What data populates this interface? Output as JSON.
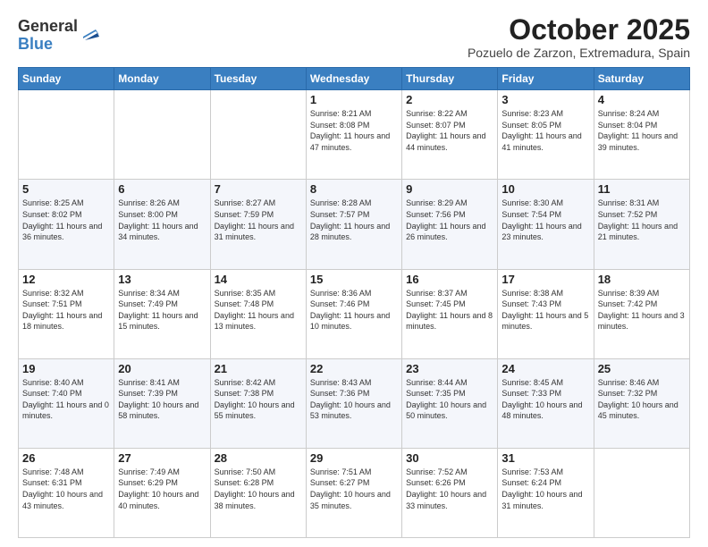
{
  "logo": {
    "general": "General",
    "blue": "Blue"
  },
  "header": {
    "month": "October 2025",
    "location": "Pozuelo de Zarzon, Extremadura, Spain"
  },
  "days_of_week": [
    "Sunday",
    "Monday",
    "Tuesday",
    "Wednesday",
    "Thursday",
    "Friday",
    "Saturday"
  ],
  "weeks": [
    [
      {
        "day": "",
        "sunrise": "",
        "sunset": "",
        "daylight": ""
      },
      {
        "day": "",
        "sunrise": "",
        "sunset": "",
        "daylight": ""
      },
      {
        "day": "",
        "sunrise": "",
        "sunset": "",
        "daylight": ""
      },
      {
        "day": "1",
        "sunrise": "Sunrise: 8:21 AM",
        "sunset": "Sunset: 8:08 PM",
        "daylight": "Daylight: 11 hours and 47 minutes."
      },
      {
        "day": "2",
        "sunrise": "Sunrise: 8:22 AM",
        "sunset": "Sunset: 8:07 PM",
        "daylight": "Daylight: 11 hours and 44 minutes."
      },
      {
        "day": "3",
        "sunrise": "Sunrise: 8:23 AM",
        "sunset": "Sunset: 8:05 PM",
        "daylight": "Daylight: 11 hours and 41 minutes."
      },
      {
        "day": "4",
        "sunrise": "Sunrise: 8:24 AM",
        "sunset": "Sunset: 8:04 PM",
        "daylight": "Daylight: 11 hours and 39 minutes."
      }
    ],
    [
      {
        "day": "5",
        "sunrise": "Sunrise: 8:25 AM",
        "sunset": "Sunset: 8:02 PM",
        "daylight": "Daylight: 11 hours and 36 minutes."
      },
      {
        "day": "6",
        "sunrise": "Sunrise: 8:26 AM",
        "sunset": "Sunset: 8:00 PM",
        "daylight": "Daylight: 11 hours and 34 minutes."
      },
      {
        "day": "7",
        "sunrise": "Sunrise: 8:27 AM",
        "sunset": "Sunset: 7:59 PM",
        "daylight": "Daylight: 11 hours and 31 minutes."
      },
      {
        "day": "8",
        "sunrise": "Sunrise: 8:28 AM",
        "sunset": "Sunset: 7:57 PM",
        "daylight": "Daylight: 11 hours and 28 minutes."
      },
      {
        "day": "9",
        "sunrise": "Sunrise: 8:29 AM",
        "sunset": "Sunset: 7:56 PM",
        "daylight": "Daylight: 11 hours and 26 minutes."
      },
      {
        "day": "10",
        "sunrise": "Sunrise: 8:30 AM",
        "sunset": "Sunset: 7:54 PM",
        "daylight": "Daylight: 11 hours and 23 minutes."
      },
      {
        "day": "11",
        "sunrise": "Sunrise: 8:31 AM",
        "sunset": "Sunset: 7:52 PM",
        "daylight": "Daylight: 11 hours and 21 minutes."
      }
    ],
    [
      {
        "day": "12",
        "sunrise": "Sunrise: 8:32 AM",
        "sunset": "Sunset: 7:51 PM",
        "daylight": "Daylight: 11 hours and 18 minutes."
      },
      {
        "day": "13",
        "sunrise": "Sunrise: 8:34 AM",
        "sunset": "Sunset: 7:49 PM",
        "daylight": "Daylight: 11 hours and 15 minutes."
      },
      {
        "day": "14",
        "sunrise": "Sunrise: 8:35 AM",
        "sunset": "Sunset: 7:48 PM",
        "daylight": "Daylight: 11 hours and 13 minutes."
      },
      {
        "day": "15",
        "sunrise": "Sunrise: 8:36 AM",
        "sunset": "Sunset: 7:46 PM",
        "daylight": "Daylight: 11 hours and 10 minutes."
      },
      {
        "day": "16",
        "sunrise": "Sunrise: 8:37 AM",
        "sunset": "Sunset: 7:45 PM",
        "daylight": "Daylight: 11 hours and 8 minutes."
      },
      {
        "day": "17",
        "sunrise": "Sunrise: 8:38 AM",
        "sunset": "Sunset: 7:43 PM",
        "daylight": "Daylight: 11 hours and 5 minutes."
      },
      {
        "day": "18",
        "sunrise": "Sunrise: 8:39 AM",
        "sunset": "Sunset: 7:42 PM",
        "daylight": "Daylight: 11 hours and 3 minutes."
      }
    ],
    [
      {
        "day": "19",
        "sunrise": "Sunrise: 8:40 AM",
        "sunset": "Sunset: 7:40 PM",
        "daylight": "Daylight: 11 hours and 0 minutes."
      },
      {
        "day": "20",
        "sunrise": "Sunrise: 8:41 AM",
        "sunset": "Sunset: 7:39 PM",
        "daylight": "Daylight: 10 hours and 58 minutes."
      },
      {
        "day": "21",
        "sunrise": "Sunrise: 8:42 AM",
        "sunset": "Sunset: 7:38 PM",
        "daylight": "Daylight: 10 hours and 55 minutes."
      },
      {
        "day": "22",
        "sunrise": "Sunrise: 8:43 AM",
        "sunset": "Sunset: 7:36 PM",
        "daylight": "Daylight: 10 hours and 53 minutes."
      },
      {
        "day": "23",
        "sunrise": "Sunrise: 8:44 AM",
        "sunset": "Sunset: 7:35 PM",
        "daylight": "Daylight: 10 hours and 50 minutes."
      },
      {
        "day": "24",
        "sunrise": "Sunrise: 8:45 AM",
        "sunset": "Sunset: 7:33 PM",
        "daylight": "Daylight: 10 hours and 48 minutes."
      },
      {
        "day": "25",
        "sunrise": "Sunrise: 8:46 AM",
        "sunset": "Sunset: 7:32 PM",
        "daylight": "Daylight: 10 hours and 45 minutes."
      }
    ],
    [
      {
        "day": "26",
        "sunrise": "Sunrise: 7:48 AM",
        "sunset": "Sunset: 6:31 PM",
        "daylight": "Daylight: 10 hours and 43 minutes."
      },
      {
        "day": "27",
        "sunrise": "Sunrise: 7:49 AM",
        "sunset": "Sunset: 6:29 PM",
        "daylight": "Daylight: 10 hours and 40 minutes."
      },
      {
        "day": "28",
        "sunrise": "Sunrise: 7:50 AM",
        "sunset": "Sunset: 6:28 PM",
        "daylight": "Daylight: 10 hours and 38 minutes."
      },
      {
        "day": "29",
        "sunrise": "Sunrise: 7:51 AM",
        "sunset": "Sunset: 6:27 PM",
        "daylight": "Daylight: 10 hours and 35 minutes."
      },
      {
        "day": "30",
        "sunrise": "Sunrise: 7:52 AM",
        "sunset": "Sunset: 6:26 PM",
        "daylight": "Daylight: 10 hours and 33 minutes."
      },
      {
        "day": "31",
        "sunrise": "Sunrise: 7:53 AM",
        "sunset": "Sunset: 6:24 PM",
        "daylight": "Daylight: 10 hours and 31 minutes."
      },
      {
        "day": "",
        "sunrise": "",
        "sunset": "",
        "daylight": ""
      }
    ]
  ]
}
